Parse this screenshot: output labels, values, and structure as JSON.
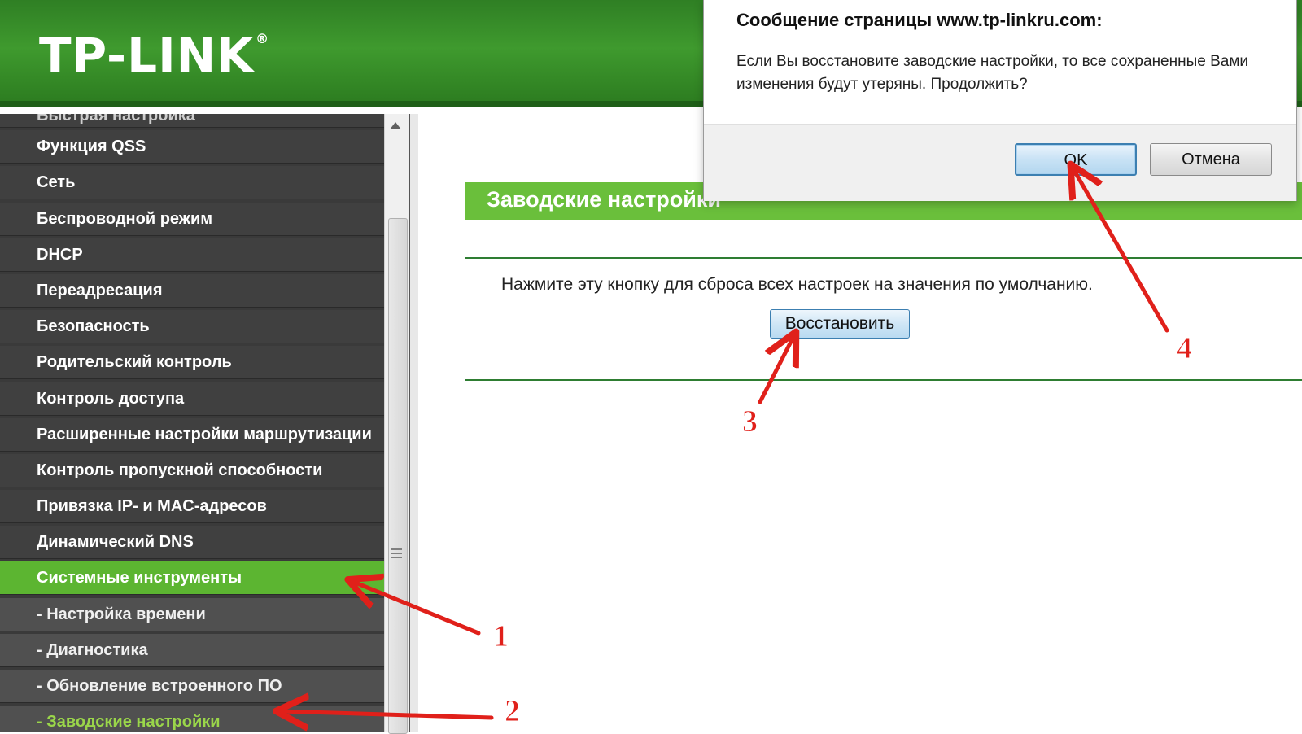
{
  "header": {
    "logo_text": "TP-LINK",
    "logo_mark": "®"
  },
  "sidebar": {
    "items": [
      {
        "label": "Быстрая настройка",
        "state": "partial"
      },
      {
        "label": "Функция QSS",
        "state": "normal"
      },
      {
        "label": "Сеть",
        "state": "normal"
      },
      {
        "label": "Беспроводной режим",
        "state": "normal"
      },
      {
        "label": "DHCP",
        "state": "normal"
      },
      {
        "label": "Переадресация",
        "state": "normal"
      },
      {
        "label": "Безопасность",
        "state": "normal"
      },
      {
        "label": "Родительский контроль",
        "state": "normal"
      },
      {
        "label": "Контроль доступа",
        "state": "normal"
      },
      {
        "label": "Расширенные настройки маршрутизации",
        "state": "normal"
      },
      {
        "label": "Контроль пропускной способности",
        "state": "normal"
      },
      {
        "label": "Привязка IP- и MAC-адресов",
        "state": "normal"
      },
      {
        "label": "Динамический DNS",
        "state": "normal"
      },
      {
        "label": "Системные инструменты",
        "state": "active"
      },
      {
        "label": "- Настройка времени",
        "state": "sub"
      },
      {
        "label": "- Диагностика",
        "state": "sub"
      },
      {
        "label": "- Обновление встроенного ПО",
        "state": "sub"
      },
      {
        "label": "- Заводские настройки",
        "state": "sub-active"
      }
    ]
  },
  "main": {
    "section_title": "Заводские настройки",
    "description": "Нажмите эту кнопку для сброса всех настроек на значения по умолчанию.",
    "restore_label": "Восстановить"
  },
  "dialog": {
    "title": "Сообщение страницы www.tp-linkru.com:",
    "message": "Если Вы восстановите заводские настройки, то все сохраненные Вами изменения будут утеряны. Продолжить?",
    "ok_label": "OK",
    "cancel_label": "Отмена"
  },
  "annotations": {
    "step1": "1",
    "step2": "2",
    "step3": "3",
    "step4": "4"
  },
  "colors": {
    "brand_green": "#3f9a2e",
    "active_green": "#5cb531",
    "sidebar_bg": "#404040",
    "arrow_red": "#e0201a"
  }
}
